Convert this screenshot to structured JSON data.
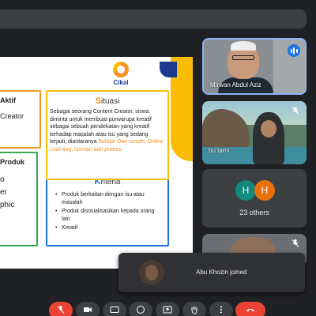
{
  "slide": {
    "logo_text": "Cikal",
    "aktif": {
      "heading": "Aktif",
      "value": "Creator"
    },
    "produk": {
      "heading": "Produk",
      "lines": [
        "o",
        "er",
        "phic"
      ]
    },
    "situasi": {
      "title_initial": "S",
      "title_rest": "ituasi",
      "body": "Sebagai seorang Content Creator, siswa diminta untuk membuat purwarupa kreatif sebagai sebuah pendekatan yang kreatif terhadap masalah atau isu yang sedang terjadi, diantaranya",
      "highlight": "Belajar Dari rumah, Online Learning, isoman dan prokes"
    },
    "kriteria": {
      "title_initial": "K",
      "title_rest": "riteria",
      "items": [
        "Produk berkaitan dengan isu atau masalah",
        "Produk disosialisasikan kepada orang lain",
        "Kreatif"
      ]
    }
  },
  "participants": [
    {
      "name": "Mirwan Abdul Aziz",
      "state": "speaking"
    },
    {
      "name": "bu tami",
      "state": "muted"
    }
  ],
  "others": {
    "avatars": [
      "H",
      "H"
    ],
    "label": "23 others"
  },
  "toast": {
    "message": "Abu Khozin joined"
  },
  "controls": [
    {
      "icon": "mic-off-icon",
      "active": true
    },
    {
      "icon": "camera-icon"
    },
    {
      "icon": "captions-icon"
    },
    {
      "icon": "emoji-icon"
    },
    {
      "icon": "present-icon"
    },
    {
      "icon": "raise-hand-icon"
    },
    {
      "icon": "more-options-icon"
    },
    {
      "icon": "end-call-icon"
    }
  ],
  "colors": {
    "accent": "#1a73e8",
    "danger": "#ea4335",
    "background": "#202124",
    "orange": "#f7931e",
    "yellow": "#fbbc05",
    "green": "#34a853"
  }
}
